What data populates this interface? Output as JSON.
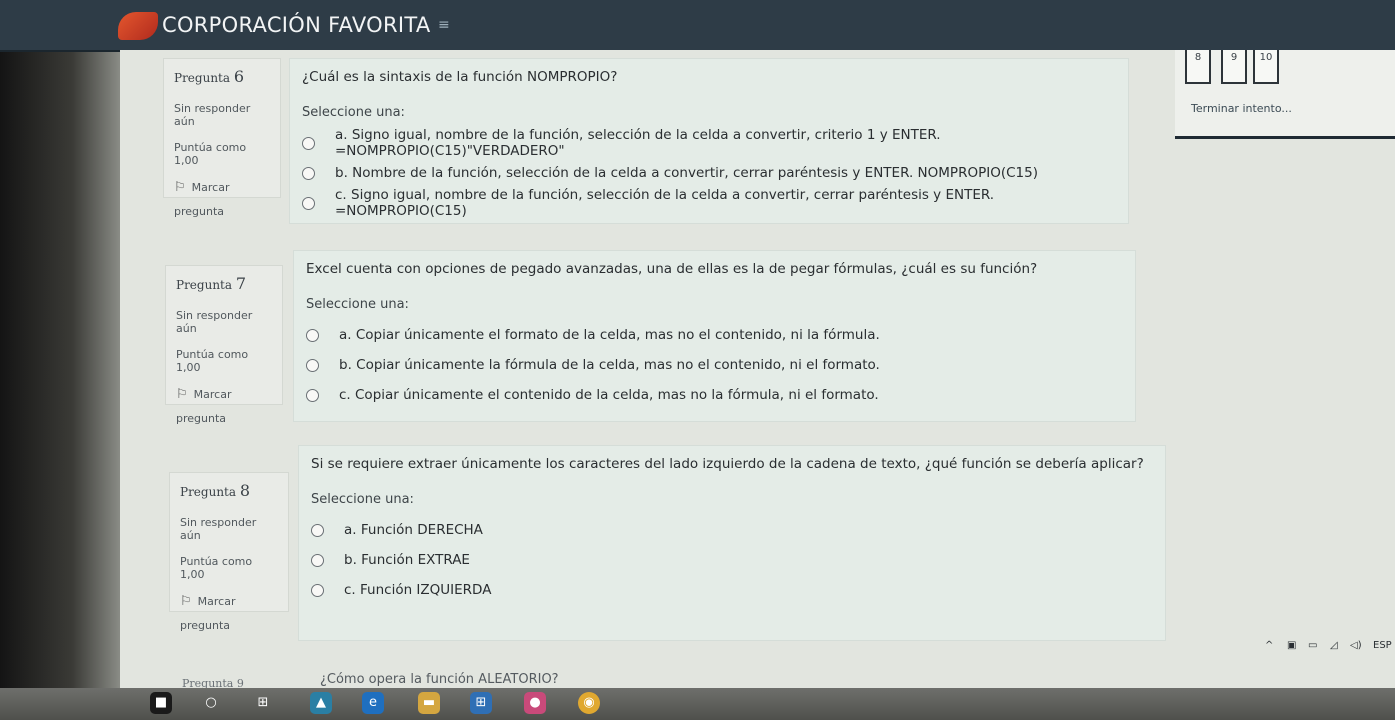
{
  "header": {
    "brand": "CORPORACIÓN FAVORITA",
    "menu_icon": "hamburger-icon"
  },
  "nav": {
    "boxes": [
      "8",
      "9",
      "10"
    ],
    "finish_label": "Terminar intento..."
  },
  "questions": [
    {
      "label": "Pregunta",
      "number": "6",
      "status": "Sin responder aún",
      "points": "Puntúa como 1,00",
      "flag_line1": "Marcar",
      "flag_line2": "pregunta",
      "text": "¿Cuál es la sintaxis de la función NOMPROPIO?",
      "select_label": "Seleccione una:",
      "options": [
        "a. Signo igual, nombre de la función, selección de la celda a convertir, criterio 1 y ENTER. =NOMPROPIO(C15)\"VERDADERO\"",
        "b. Nombre de la función, selección de la celda a convertir, cerrar paréntesis y ENTER. NOMPROPIO(C15)",
        "c. Signo igual, nombre de la función, selección de la celda a convertir, cerrar paréntesis y ENTER. =NOMPROPIO(C15)"
      ]
    },
    {
      "label": "Pregunta",
      "number": "7",
      "status": "Sin responder aún",
      "points": "Puntúa como 1,00",
      "flag_line1": "Marcar",
      "flag_line2": "pregunta",
      "text": "Excel cuenta con opciones de pegado avanzadas, una de ellas es la de pegar fórmulas, ¿cuál es su función?",
      "select_label": "Seleccione una:",
      "options": [
        "a. Copiar únicamente el formato de la celda, mas no el contenido, ni la fórmula.",
        "b. Copiar únicamente la fórmula de la celda, mas no el contenido, ni el formato.",
        "c. Copiar únicamente el contenido de la celda, mas no la fórmula, ni el formato."
      ]
    },
    {
      "label": "Pregunta",
      "number": "8",
      "status": "Sin responder aún",
      "points": "Puntúa como 1,00",
      "flag_line1": "Marcar",
      "flag_line2": "pregunta",
      "text": "Si se requiere extraer únicamente los caracteres del lado izquierdo de la cadena de texto, ¿qué función se debería aplicar?",
      "select_label": "Seleccione una:",
      "options": [
        "a. Función DERECHA",
        "b. Función EXTRAE",
        "c. Función IZQUIERDA"
      ]
    }
  ],
  "partial": {
    "question_label": "Pregunta 9",
    "text": "¿Cómo opera la función ALEATORIO?"
  },
  "tray": {
    "language": "ESP"
  }
}
